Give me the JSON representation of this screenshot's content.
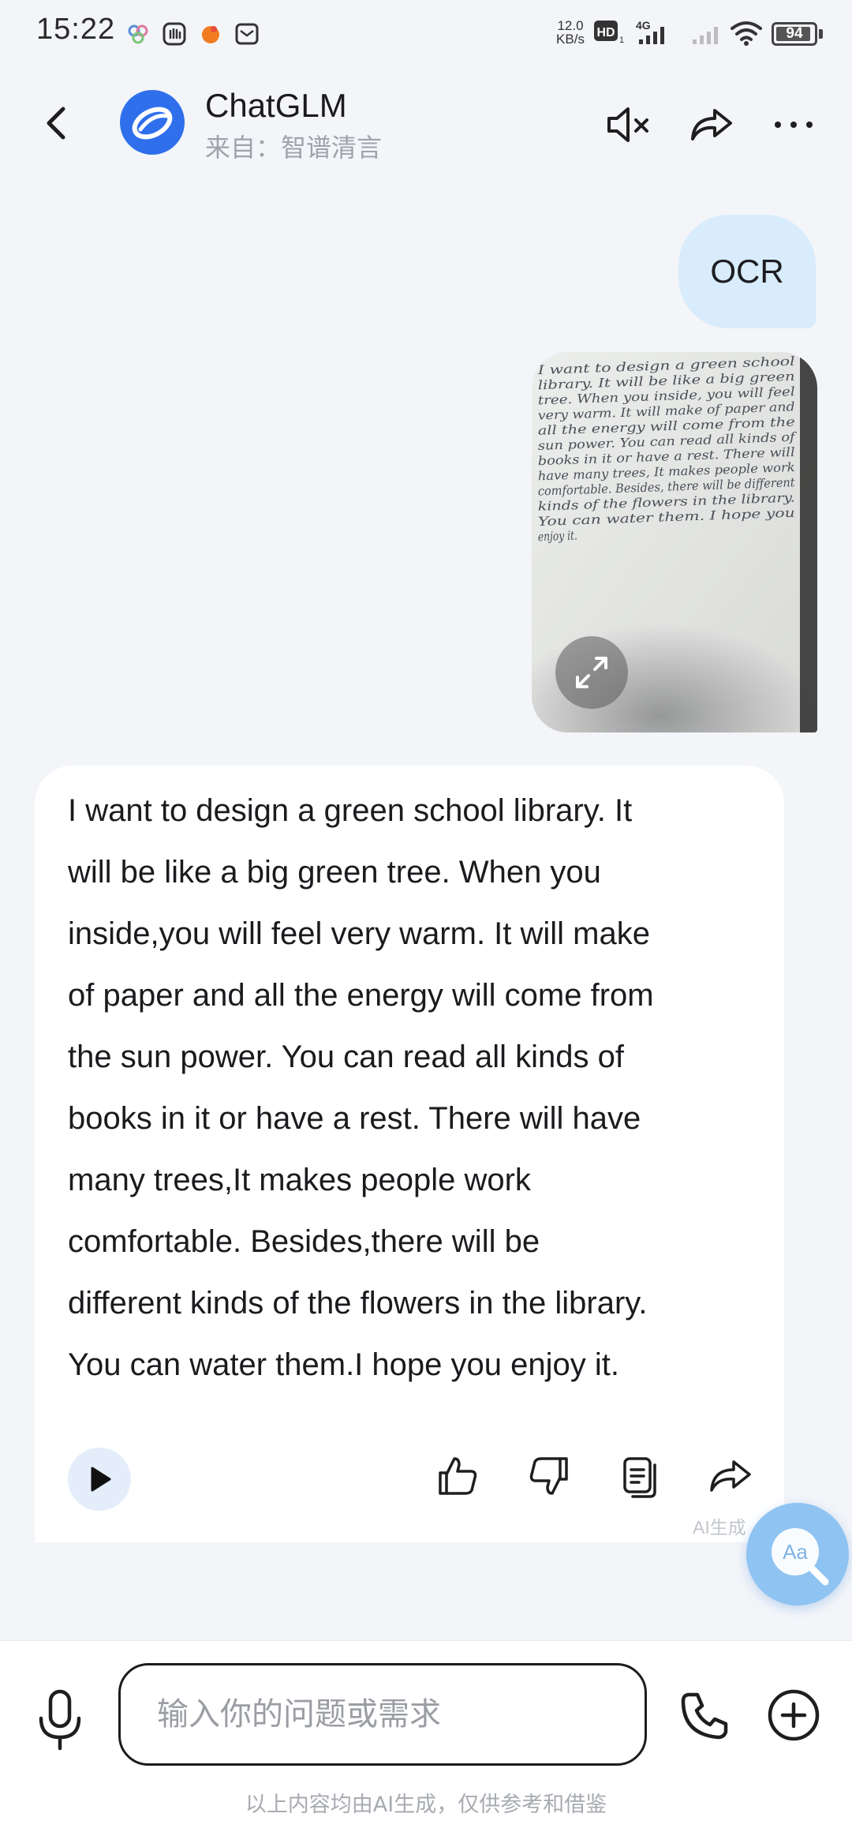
{
  "status_bar": {
    "time": "15:22",
    "net_speed_value": "12.0",
    "net_speed_unit": "KB/s",
    "hd_label": "HD",
    "network": "4G",
    "battery": "94",
    "battery_level": 0.94,
    "notification_icons": [
      "bubbles-app-icon",
      "hand-app-icon",
      "orange-app-icon",
      "mail-icon"
    ]
  },
  "header": {
    "title": "ChatGLM",
    "subtitle": "来自：智谱清言",
    "icons": [
      "back-arrow-icon",
      "mute-icon",
      "share-icon",
      "more-icon"
    ]
  },
  "chat": {
    "user_message": "OCR",
    "user_image_handwriting": [
      "I want to design a green school",
      "library. It will be like a big green",
      "tree. When you inside, you will feel",
      "very warm. It will make of paper and",
      "all the energy will come from the",
      "sun power. You can read all kinds of",
      "books in it or have a rest. There will",
      "have many trees, It makes people work",
      "comfortable. Besides, there will be different",
      "kinds of the flowers in the library.",
      "You can water them. I hope you",
      "enjoy it."
    ],
    "ai_response_lines": [
      "I want to design a green school library. It",
      "will be like a big green tree. When you",
      "inside,you will feel very warm. It will make",
      "of paper and all the energy will come from",
      "the sun power. You can read all kinds of",
      "books in it or have a rest. There will have",
      "many trees,It makes people work",
      "comfortable. Besides,there will be",
      "different kinds of the flowers in the library.",
      "You can water them.I hope you enjoy it."
    ],
    "ai_generated_label": "AI生成",
    "font_button_label": "Aa"
  },
  "input": {
    "placeholder": "输入你的问题或需求",
    "disclaimer": "以上内容均由AI生成，仅供参考和借鉴"
  },
  "colors": {
    "accent_blue": "#2f6fec",
    "user_bubble": "#d8ecfb",
    "background": "#f3f5f9",
    "font_fab": "#8ec3f2"
  }
}
